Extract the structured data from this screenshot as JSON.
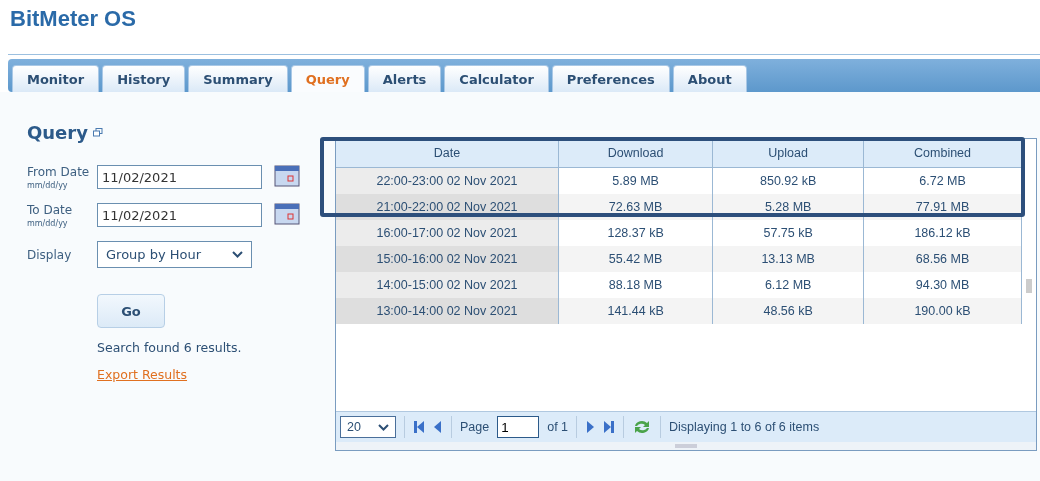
{
  "app_title": "BitMeter OS",
  "tabs": [
    {
      "label": "Monitor",
      "selected": false
    },
    {
      "label": "History",
      "selected": false
    },
    {
      "label": "Summary",
      "selected": false
    },
    {
      "label": "Query",
      "selected": true
    },
    {
      "label": "Alerts",
      "selected": false
    },
    {
      "label": "Calculator",
      "selected": false
    },
    {
      "label": "Preferences",
      "selected": false
    },
    {
      "label": "About",
      "selected": false
    }
  ],
  "heading": "Query",
  "form": {
    "from_label": "From Date",
    "from_hint": "mm/dd/yy",
    "from_value": "11/02/2021",
    "to_label": "To Date",
    "to_hint": "mm/dd/yy",
    "to_value": "11/02/2021",
    "display_label": "Display",
    "display_value": "Group by Hour",
    "go": "Go",
    "result": "Search found 6 results.",
    "export": "Export Results"
  },
  "table": {
    "columns": [
      "Date",
      "Download",
      "Upload",
      "Combined"
    ],
    "rows": [
      [
        "22:00-23:00 02 Nov 2021",
        "5.89 MB",
        "850.92 kB",
        "6.72 MB"
      ],
      [
        "21:00-22:00 02 Nov 2021",
        "72.63 MB",
        "5.28 MB",
        "77.91 MB"
      ],
      [
        "16:00-17:00 02 Nov 2021",
        "128.37 kB",
        "57.75 kB",
        "186.12 kB"
      ],
      [
        "15:00-16:00 02 Nov 2021",
        "55.42 MB",
        "13.13 MB",
        "68.56 MB"
      ],
      [
        "14:00-15:00 02 Nov 2021",
        "88.18 MB",
        "6.12 MB",
        "94.30 MB"
      ],
      [
        "13:00-14:00 02 Nov 2021",
        "141.44 kB",
        "48.56 kB",
        "190.00 kB"
      ]
    ]
  },
  "pager": {
    "page_size": "20",
    "page_label": "Page",
    "page": "1",
    "of": "of 1",
    "status": "Displaying 1 to 6 of 6 items"
  }
}
